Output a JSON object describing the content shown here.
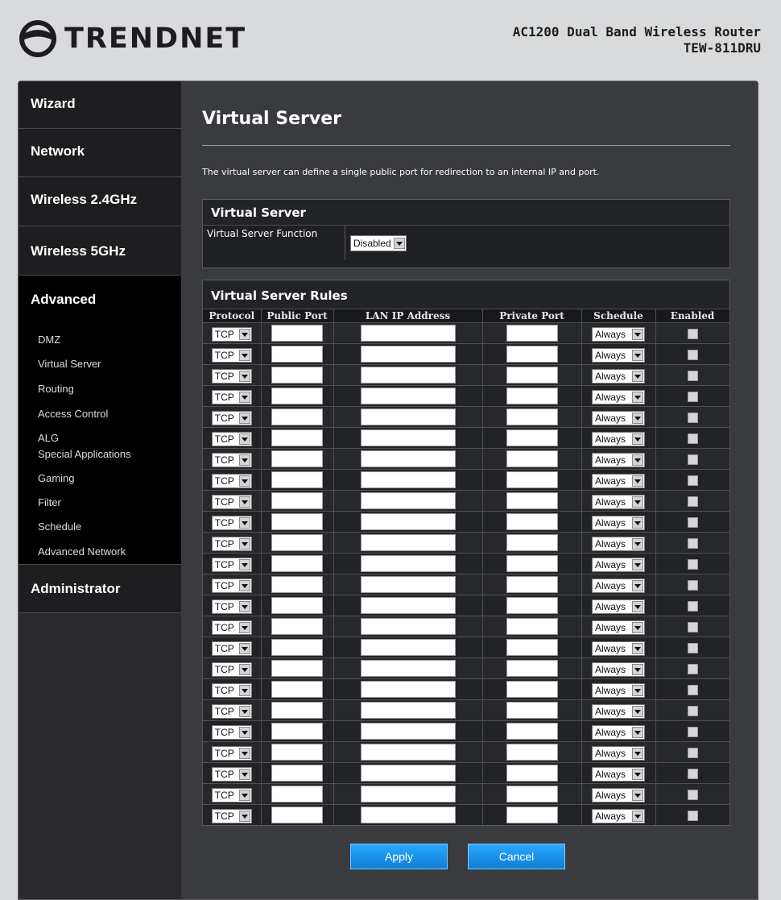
{
  "brand": {
    "name": "TRENDNET",
    "logo_icon": "trendnet-logo-icon"
  },
  "product": {
    "line1": "AC1200 Dual Band Wireless Router",
    "line2": "TEW-811DRU"
  },
  "nav": {
    "items": [
      {
        "label": "Wizard"
      },
      {
        "label": "Network"
      },
      {
        "label": "Wireless 2.4GHz"
      },
      {
        "label": "Wireless 5GHz"
      },
      {
        "label": "Advanced"
      },
      {
        "label": "Administrator"
      }
    ],
    "sub": [
      {
        "label": "DMZ"
      },
      {
        "label": "Virtual Server"
      },
      {
        "label": "Routing"
      },
      {
        "label": "Access Control"
      },
      {
        "label": "ALG"
      },
      {
        "label": "Special Applications"
      },
      {
        "label": "Gaming"
      },
      {
        "label": "Filter"
      },
      {
        "label": "Schedule"
      },
      {
        "label": "Advanced Network"
      }
    ]
  },
  "page": {
    "title": "Virtual Server",
    "description": "The virtual server can define a single public port for redirection to an internal IP and port."
  },
  "vs_panel": {
    "title": "Virtual Server",
    "function_label": "Virtual Server Function",
    "function_value": "Disabled"
  },
  "rules": {
    "title": "Virtual Server Rules",
    "headers": [
      "Protocol",
      "Public Port",
      "LAN IP Address",
      "Private Port",
      "Schedule",
      "Enabled"
    ],
    "rows": [
      {
        "protocol": "TCP",
        "public_port": "",
        "lan_ip": "",
        "private_port": "",
        "schedule": "Always"
      },
      {
        "protocol": "TCP",
        "public_port": "",
        "lan_ip": "",
        "private_port": "",
        "schedule": "Always"
      },
      {
        "protocol": "TCP",
        "public_port": "",
        "lan_ip": "",
        "private_port": "",
        "schedule": "Always"
      },
      {
        "protocol": "TCP",
        "public_port": "",
        "lan_ip": "",
        "private_port": "",
        "schedule": "Always"
      },
      {
        "protocol": "TCP",
        "public_port": "",
        "lan_ip": "",
        "private_port": "",
        "schedule": "Always"
      },
      {
        "protocol": "TCP",
        "public_port": "",
        "lan_ip": "",
        "private_port": "",
        "schedule": "Always"
      },
      {
        "protocol": "TCP",
        "public_port": "",
        "lan_ip": "",
        "private_port": "",
        "schedule": "Always"
      },
      {
        "protocol": "TCP",
        "public_port": "",
        "lan_ip": "",
        "private_port": "",
        "schedule": "Always"
      },
      {
        "protocol": "TCP",
        "public_port": "",
        "lan_ip": "",
        "private_port": "",
        "schedule": "Always"
      },
      {
        "protocol": "TCP",
        "public_port": "",
        "lan_ip": "",
        "private_port": "",
        "schedule": "Always"
      },
      {
        "protocol": "TCP",
        "public_port": "",
        "lan_ip": "",
        "private_port": "",
        "schedule": "Always"
      },
      {
        "protocol": "TCP",
        "public_port": "",
        "lan_ip": "",
        "private_port": "",
        "schedule": "Always"
      },
      {
        "protocol": "TCP",
        "public_port": "",
        "lan_ip": "",
        "private_port": "",
        "schedule": "Always"
      },
      {
        "protocol": "TCP",
        "public_port": "",
        "lan_ip": "",
        "private_port": "",
        "schedule": "Always"
      },
      {
        "protocol": "TCP",
        "public_port": "",
        "lan_ip": "",
        "private_port": "",
        "schedule": "Always"
      },
      {
        "protocol": "TCP",
        "public_port": "",
        "lan_ip": "",
        "private_port": "",
        "schedule": "Always"
      },
      {
        "protocol": "TCP",
        "public_port": "",
        "lan_ip": "",
        "private_port": "",
        "schedule": "Always"
      },
      {
        "protocol": "TCP",
        "public_port": "",
        "lan_ip": "",
        "private_port": "",
        "schedule": "Always"
      },
      {
        "protocol": "TCP",
        "public_port": "",
        "lan_ip": "",
        "private_port": "",
        "schedule": "Always"
      },
      {
        "protocol": "TCP",
        "public_port": "",
        "lan_ip": "",
        "private_port": "",
        "schedule": "Always"
      },
      {
        "protocol": "TCP",
        "public_port": "",
        "lan_ip": "",
        "private_port": "",
        "schedule": "Always"
      },
      {
        "protocol": "TCP",
        "public_port": "",
        "lan_ip": "",
        "private_port": "",
        "schedule": "Always"
      },
      {
        "protocol": "TCP",
        "public_port": "",
        "lan_ip": "",
        "private_port": "",
        "schedule": "Always"
      },
      {
        "protocol": "TCP",
        "public_port": "",
        "lan_ip": "",
        "private_port": "",
        "schedule": "Always"
      }
    ]
  },
  "buttons": {
    "apply": "Apply",
    "cancel": "Cancel"
  },
  "colors": {
    "accent": "#1a94f0",
    "frame": "#0e0e10",
    "content_bg": "#3a3b3f",
    "page_bg": "#d9dadc"
  }
}
